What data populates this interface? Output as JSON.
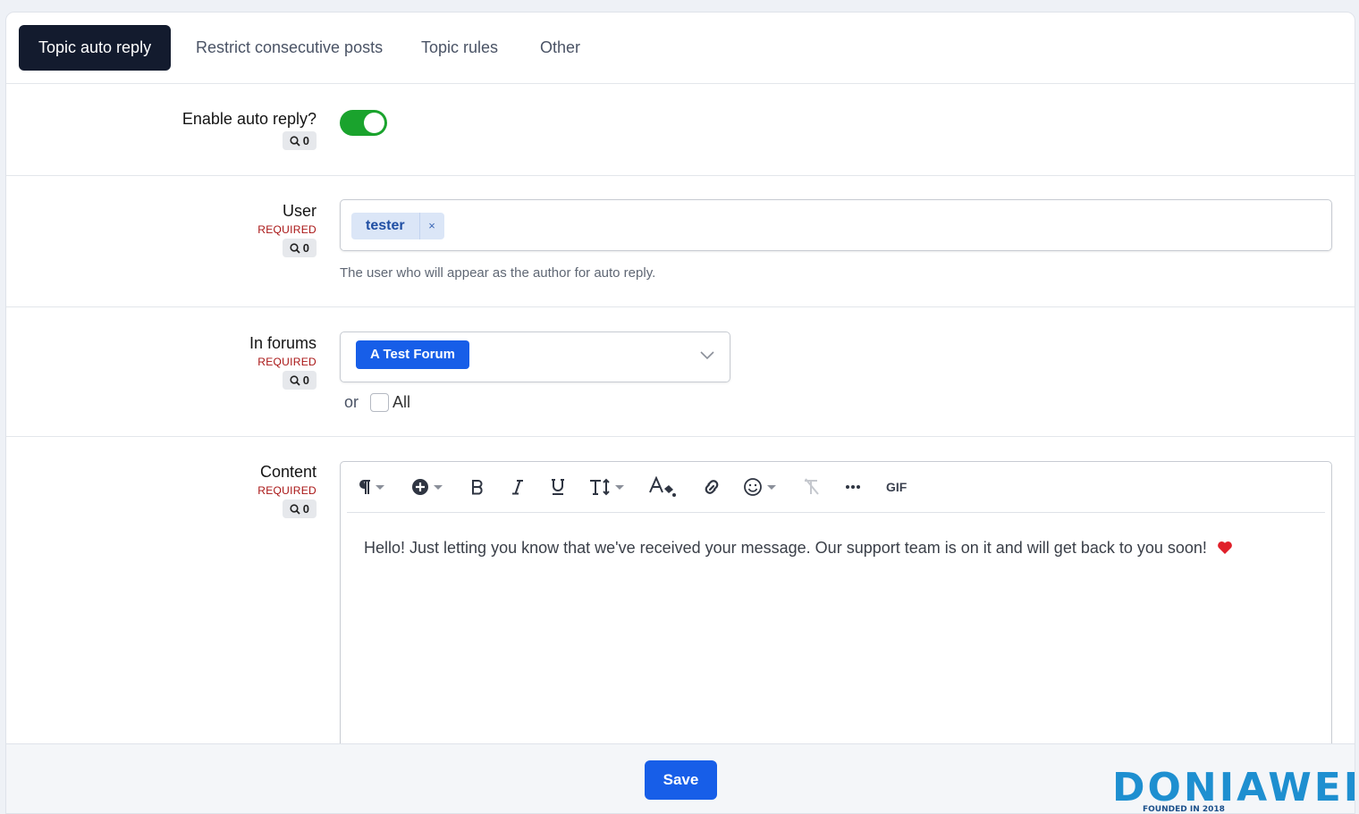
{
  "tabs": [
    {
      "label": "Topic auto reply",
      "active": true
    },
    {
      "label": "Restrict consecutive posts",
      "active": false
    },
    {
      "label": "Topic rules",
      "active": false
    },
    {
      "label": "Other",
      "active": false
    }
  ],
  "enable_auto_reply": {
    "label": "Enable auto reply?",
    "search_count": "0",
    "enabled": true
  },
  "user": {
    "label": "User",
    "required": "REQUIRED",
    "search_count": "0",
    "tag": "tester",
    "remove": "×",
    "hint": "The user who will appear as the author for auto reply."
  },
  "forums": {
    "label": "In forums",
    "required": "REQUIRED",
    "search_count": "0",
    "selected": "A Test Forum",
    "or_text": "or",
    "all_label": "All",
    "all_checked": false
  },
  "content": {
    "label": "Content",
    "required": "REQUIRED",
    "search_count": "0",
    "gif_label": "GIF",
    "text": "Hello! Just letting you know that we've received your message. Our support team is on it and will get back to you soon!"
  },
  "footer": {
    "save_label": "Save"
  },
  "watermark": {
    "brand": "DONIAWEB",
    "tagline": "FOUNDED IN 2018"
  },
  "colors": {
    "accent": "#175ee8",
    "toggle_on": "#1aa32d",
    "required": "#a91515",
    "active_tab": "#131b2e"
  }
}
